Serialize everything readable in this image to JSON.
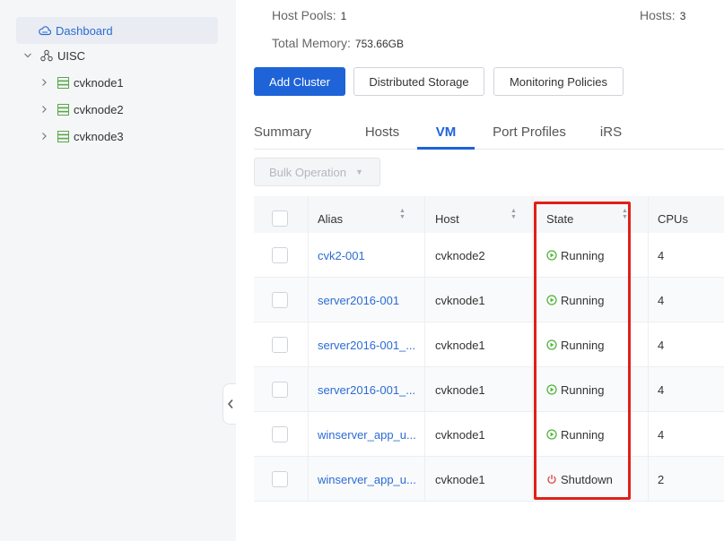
{
  "sidebar": {
    "selected": {
      "label": "Dashboard",
      "icon": "cloud-icon"
    },
    "root": {
      "label": "UISC",
      "icon": "cluster-icon"
    },
    "nodes": [
      {
        "label": "cvknode1",
        "icon": "server-icon"
      },
      {
        "label": "cvknode2",
        "icon": "server-icon"
      },
      {
        "label": "cvknode3",
        "icon": "server-icon"
      }
    ]
  },
  "summary": {
    "host_pools_label": "Host Pools:",
    "host_pools_value": "1",
    "hosts_label": "Hosts:",
    "hosts_value": "3",
    "memory_label": "Total Memory:",
    "memory_value": "753.66GB"
  },
  "actions": {
    "add_cluster": "Add Cluster",
    "distributed_storage": "Distributed Storage",
    "monitoring_policies": "Monitoring Policies"
  },
  "tabs": [
    "Summary",
    "Hosts",
    "VM",
    "Port Profiles",
    "iRS"
  ],
  "active_tab": "VM",
  "bulk_operation": {
    "label": "Bulk Operation",
    "icon": "caret-down-icon",
    "disabled": true
  },
  "table": {
    "columns": [
      "Alias",
      "Host",
      "State",
      "CPUs"
    ],
    "rows": [
      {
        "alias": "cvk2-001",
        "host": "cvknode2",
        "state": "Running",
        "cpus": "4"
      },
      {
        "alias": "server2016-001",
        "host": "cvknode1",
        "state": "Running",
        "cpus": "4"
      },
      {
        "alias": "server2016-001_...",
        "host": "cvknode1",
        "state": "Running",
        "cpus": "4"
      },
      {
        "alias": "server2016-001_...",
        "host": "cvknode1",
        "state": "Running",
        "cpus": "4"
      },
      {
        "alias": "winserver_app_u...",
        "host": "cvknode1",
        "state": "Running",
        "cpus": "4"
      },
      {
        "alias": "winserver_app_u...",
        "host": "cvknode1",
        "state": "Shutdown",
        "cpus": "2"
      }
    ]
  },
  "colors": {
    "accent": "#1f63d8",
    "link": "#2b6cd4",
    "running": "#52b43c",
    "shutdown": "#e0403a",
    "highlight": "#e0201a"
  }
}
